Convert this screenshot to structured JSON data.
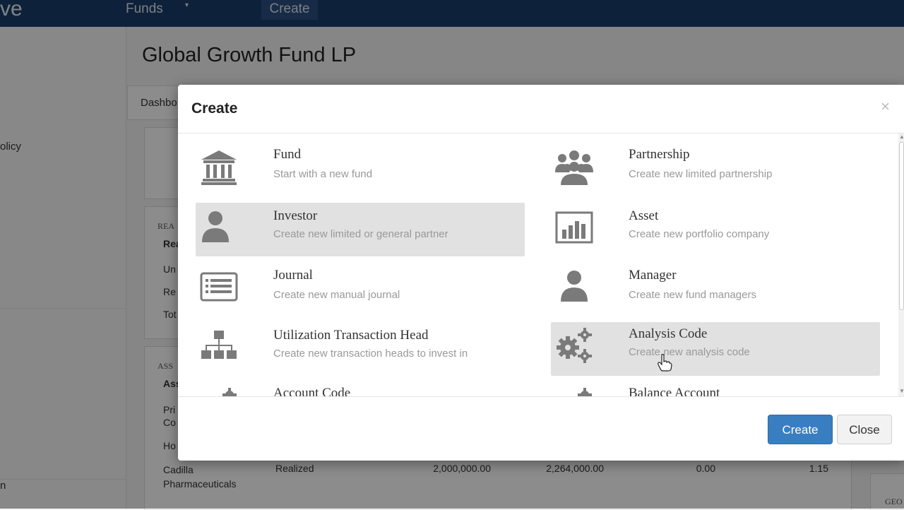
{
  "navbar": {
    "brand": "ve",
    "funds_label": "Funds",
    "caret": "▾",
    "create_label": "Create"
  },
  "sidebar": {
    "policy_fragment": "olicy",
    "bottom_fragment": "n"
  },
  "page": {
    "title": "Global Growth Fund LP",
    "tab_dashboard": "Dashbo",
    "section1_label": "REA",
    "section1_header": "Rea",
    "section1_rows": [
      "Un",
      "Re",
      "Tot"
    ],
    "section2_label": "ASS",
    "section2_header": "Ass",
    "section2_rows": [
      "Pri\nCo",
      "Ho"
    ],
    "bottom_row": {
      "name": "Cadilla\nPharmaceuticals",
      "status": "Realized",
      "v1": "2,000,000.00",
      "v2": "2,264,000.00",
      "v3": "0.00",
      "v4": "1.15"
    },
    "geo_label": "GEO"
  },
  "modal": {
    "title": "Create",
    "close_glyph": "×",
    "items": [
      {
        "title": "Fund",
        "desc": "Start with a new fund",
        "icon": "bank-icon"
      },
      {
        "title": "Partnership",
        "desc": "Create new limited partnership",
        "icon": "group-icon"
      },
      {
        "title": "Investor",
        "desc": "Create new limited or general partner",
        "icon": "user-icon"
      },
      {
        "title": "Asset",
        "desc": "Create new portfolio company",
        "icon": "bar-chart-icon"
      },
      {
        "title": "Journal",
        "desc": "Create new manual journal",
        "icon": "list-icon"
      },
      {
        "title": "Manager",
        "desc": "Create new fund managers",
        "icon": "user-icon"
      },
      {
        "title": "Utilization Transaction Head",
        "desc": "Create new transaction heads to invest in",
        "icon": "sitemap-icon"
      },
      {
        "title": "Analysis Code",
        "desc": "Create new analysis code",
        "icon": "gears-icon"
      },
      {
        "title": "Account Code",
        "desc": "",
        "icon": "gears-icon"
      },
      {
        "title": "Balance Account",
        "desc": "",
        "icon": "gears-icon"
      }
    ],
    "buttons": {
      "create": "Create",
      "close": "Close"
    }
  },
  "colors": {
    "navbar": "#1b3d6b",
    "primary_button": "#3a7ec2",
    "highlight": "#e1e1e1",
    "icon": "#7a7a7a"
  }
}
